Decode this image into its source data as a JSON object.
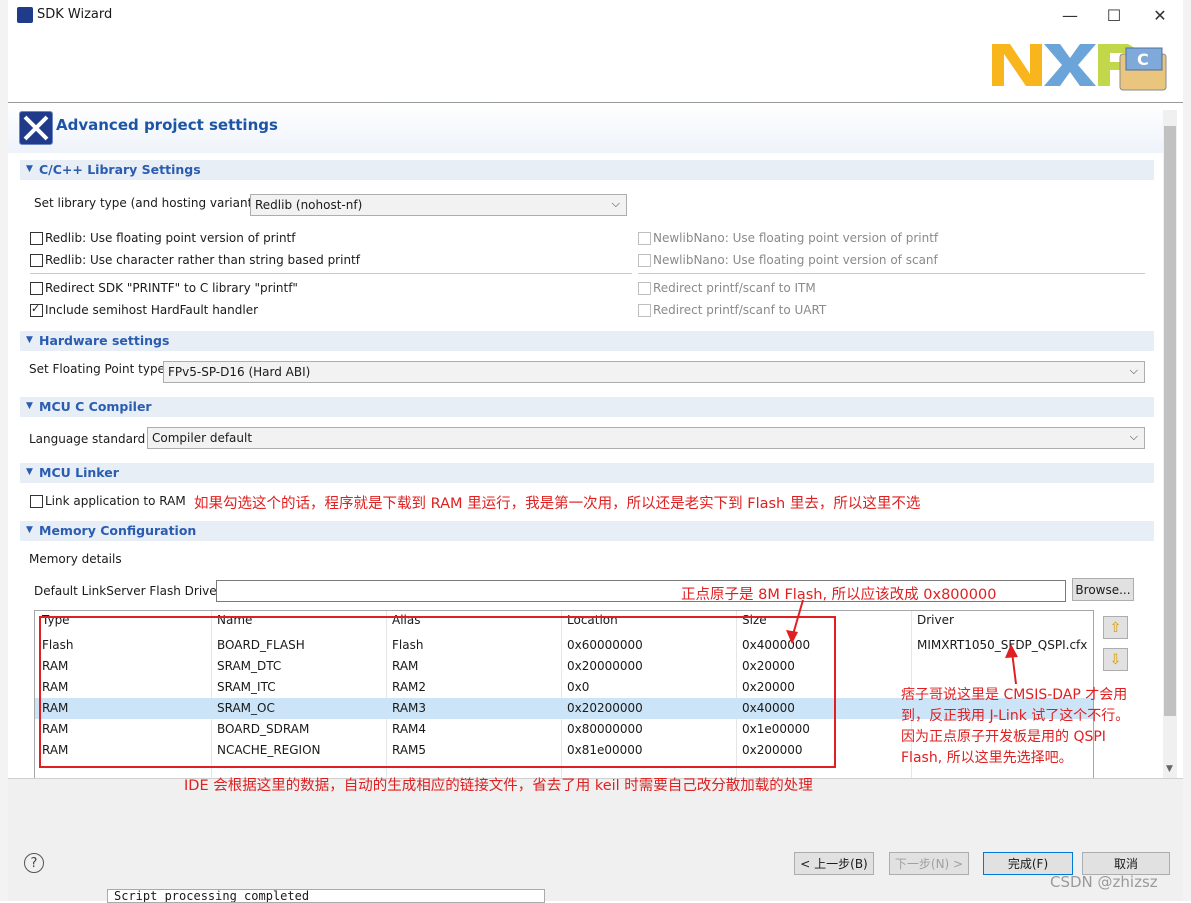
{
  "window": {
    "title": "SDK Wizard",
    "min": "—",
    "max": "☐",
    "close": "✕"
  },
  "header": {
    "title": "Advanced project settings"
  },
  "library": {
    "section": "C/C++ Library Settings",
    "type_label": "Set library type (and hosting variant)",
    "type_value": "Redlib (nohost-nf)",
    "left_checks": [
      {
        "label": "Redlib: Use floating point version of printf",
        "checked": false
      },
      {
        "label": "Redlib: Use character rather than string based printf",
        "checked": false
      },
      {
        "label": "Redirect SDK \"PRINTF\" to C library \"printf\"",
        "checked": false
      },
      {
        "label": "Include semihost HardFault handler",
        "checked": true
      }
    ],
    "right_checks": [
      {
        "label": "NewlibNano: Use floating point version of printf"
      },
      {
        "label": "NewlibNano: Use floating point version of scanf"
      },
      {
        "label": "Redirect printf/scanf to ITM"
      },
      {
        "label": "Redirect printf/scanf to UART"
      }
    ]
  },
  "hardware": {
    "section": "Hardware settings",
    "fp_label": "Set Floating Point type",
    "fp_value": "FPv5-SP-D16 (Hard ABI)"
  },
  "compiler": {
    "section": "MCU C Compiler",
    "lang_label": "Language standard",
    "lang_value": "Compiler default"
  },
  "linker": {
    "section": "MCU Linker",
    "ram_label": "Link application to RAM",
    "ram_checked": false
  },
  "memory": {
    "section": "Memory Configuration",
    "details_label": "Memory details",
    "flash_driver_label": "Default LinkServer Flash Driver",
    "flash_driver_value": "",
    "browse": "Browse...",
    "columns": [
      "Type",
      "Name",
      "Alias",
      "Location",
      "Size",
      "Driver"
    ],
    "rows": [
      [
        "Flash",
        "BOARD_FLASH",
        "Flash",
        "0x60000000",
        "0x4000000",
        "MIMXRT1050_SFDP_QSPI.cfx"
      ],
      [
        "RAM",
        "SRAM_DTC",
        "RAM",
        "0x20000000",
        "0x20000",
        ""
      ],
      [
        "RAM",
        "SRAM_ITC",
        "RAM2",
        "0x0",
        "0x20000",
        ""
      ],
      [
        "RAM",
        "SRAM_OC",
        "RAM3",
        "0x20200000",
        "0x40000",
        ""
      ],
      [
        "RAM",
        "BOARD_SDRAM",
        "RAM4",
        "0x80000000",
        "0x1e00000",
        ""
      ],
      [
        "RAM",
        "NCACHE_REGION",
        "RAM5",
        "0x81e00000",
        "0x200000",
        ""
      ]
    ],
    "selected_row": 3
  },
  "annotations": {
    "ram_note": "如果勾选这个的话，程序就是下载到 RAM 里运行，我是第一次用，所以还是老实下到 Flash 里去，所以这里不选",
    "flash_note": "正点原子是 8M Flash, 所以应该改成 0x800000",
    "driver_note": "痞子哥说这里是 CMSIS-DAP 才会用到，反正我用 J-Link 试了这个不行。因为正点原子开发板是用的 QSPI Flash, 所以这里先选择吧。",
    "table_note": "IDE 会根据这里的数据，自动的生成相应的链接文件，省去了用 keil 时需要自己改分散加载的处理"
  },
  "footer": {
    "back": "< 上一步(B)",
    "next": "下一步(N) >",
    "finish": "完成(F)",
    "cancel": "取消",
    "console": "Script processing completed",
    "watermark": "CSDN @zhizsz"
  },
  "colors": {
    "section_text": "#2a5cb0",
    "annotation": "#e02020",
    "selected_row": "#cce4f7"
  }
}
